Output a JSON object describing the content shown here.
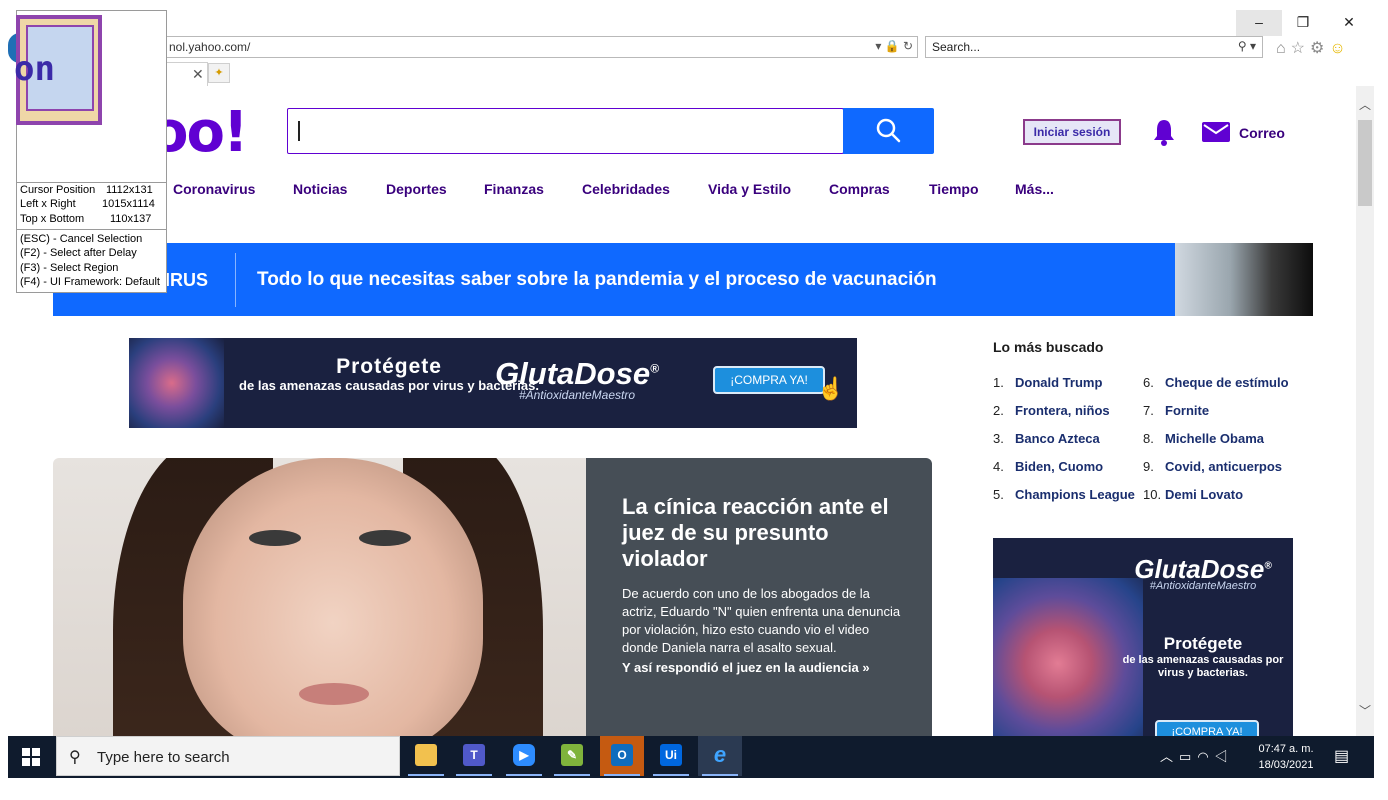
{
  "browser": {
    "address": "nol.yahoo.com/",
    "search_placeholder": "Search...",
    "window_controls": {
      "minimize": "–",
      "restore": "❐",
      "close": "✕"
    },
    "tab_close": "✕"
  },
  "yahoo": {
    "logo": "oo!",
    "signin": "Iniciar sesión",
    "mail_label": "Correo",
    "nav": [
      "Coronavirus",
      "Noticias",
      "Deportes",
      "Finanzas",
      "Celebridades",
      "Vida y Estilo",
      "Compras",
      "Tiempo",
      "Más..."
    ]
  },
  "banner": {
    "label": "IRUS",
    "text": "Todo lo que necesitas saber sobre la pandemia y el proceso de vacunación"
  },
  "ad": {
    "headline": "Protégete",
    "subline": "de las amenazas causadas por virus y bacterias.",
    "brand": "GlutaDose",
    "brand_mark": "®",
    "tagline": "#AntioxidanteMaestro",
    "cta": "¡COMPRA YA!"
  },
  "story": {
    "title": "La cínica reacción ante el juez de su presunto violador",
    "description": "De acuerdo con uno de los abogados de la actriz, Eduardo \"N\" quien enfrenta una denuncia por violación, hizo esto cuando vio el video donde Daniela narra el asalto sexual.",
    "link": "Y así respondió el juez en la audiencia »"
  },
  "trending": {
    "title": "Lo más buscado",
    "items": [
      {
        "num": "1.",
        "label": "Donald Trump"
      },
      {
        "num": "2.",
        "label": "Frontera, niños"
      },
      {
        "num": "3.",
        "label": "Banco Azteca"
      },
      {
        "num": "4.",
        "label": "Biden, Cuomo"
      },
      {
        "num": "5.",
        "label": "Champions League"
      },
      {
        "num": "6.",
        "label": "Cheque de estímulo"
      },
      {
        "num": "7.",
        "label": "Fornite"
      },
      {
        "num": "8.",
        "label": "Michelle Obama"
      },
      {
        "num": "9.",
        "label": "Covid, anticuerpos"
      },
      {
        "num": "10.",
        "label": "Demi Lovato"
      }
    ]
  },
  "tool": {
    "magnifier_text": "on",
    "rows": [
      {
        "label": "Cursor Position",
        "value": "1112x131"
      },
      {
        "label": "Left x Right",
        "value": "1015x1114"
      },
      {
        "label": "Top x Bottom",
        "value": "110x137"
      }
    ],
    "shortcuts": [
      "(ESC) - Cancel Selection",
      "(F2)    - Select after Delay",
      "(F3)    - Select Region",
      "(F4)    - UI Framework: Default"
    ]
  },
  "taskbar": {
    "search_placeholder": "Type here to search",
    "time": "07:47 a. m.",
    "date": "18/03/2021",
    "apps": [
      "File Explorer",
      "Teams",
      "Zoom",
      "Notepad",
      "Outlook",
      "UiPath",
      "Internet Explorer"
    ],
    "uipath_label": "Ui",
    "outlook_label": "O"
  }
}
